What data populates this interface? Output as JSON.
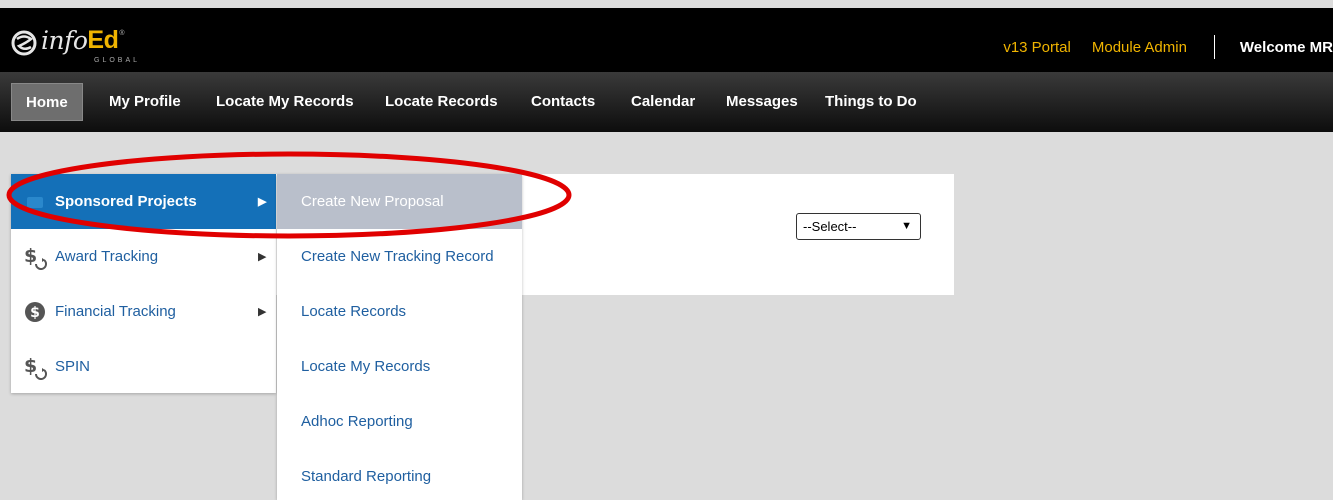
{
  "logo": {
    "info": "info",
    "ed": "Ed",
    "reg": "®",
    "global": "GLOBAL"
  },
  "top_links": {
    "portal": "v13 Portal",
    "module_admin": "Module Admin",
    "welcome": "Welcome MR"
  },
  "nav": {
    "items": [
      {
        "label": "Home",
        "active": true
      },
      {
        "label": "My Profile"
      },
      {
        "label": "Locate My Records"
      },
      {
        "label": "Locate Records"
      },
      {
        "label": "Contacts"
      },
      {
        "label": "Calendar"
      },
      {
        "label": "Messages"
      },
      {
        "label": "Things to Do"
      }
    ]
  },
  "left_menu": {
    "items": [
      {
        "label": "Sponsored Projects",
        "icon": "sponsored-projects-icon",
        "active": true
      },
      {
        "label": "Award Tracking",
        "icon": "dollar-cycle-icon"
      },
      {
        "label": "Financial Tracking",
        "icon": "dollar-circle-icon"
      },
      {
        "label": "SPIN",
        "icon": "dollar-cycle-icon"
      }
    ],
    "arrow": "▶"
  },
  "sub_menu": {
    "items": [
      {
        "label": "Create New Proposal",
        "active": true
      },
      {
        "label": "Create New Tracking Record"
      },
      {
        "label": "Locate Records"
      },
      {
        "label": "Locate My Records"
      },
      {
        "label": "Adhoc Reporting"
      },
      {
        "label": "Standard Reporting"
      }
    ]
  },
  "select": {
    "value": "--Select--",
    "arrow": "▼"
  },
  "colors": {
    "accent_gold": "#f0b400",
    "active_blue": "#1470b8",
    "link_blue": "#1f5fa0",
    "highlight_oval": "#e00000"
  }
}
